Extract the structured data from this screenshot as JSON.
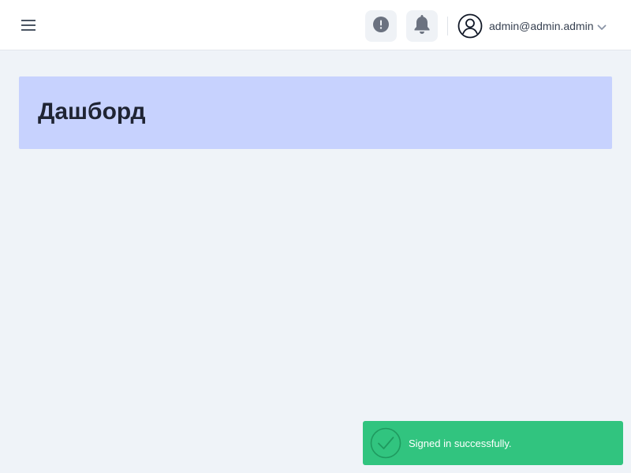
{
  "header": {
    "menu_icon": "hamburger-menu-icon",
    "info_icon": "exclamation-circle-icon",
    "notifications_icon": "bell-icon",
    "user": {
      "avatar_icon": "user-circle-icon",
      "email": "admin@admin.admin",
      "dropdown_icon": "chevron-down-icon"
    }
  },
  "main": {
    "title": "Дашборд"
  },
  "toast": {
    "icon": "check-circle-icon",
    "message": "Signed in successfully.",
    "color": "#31c47f"
  },
  "colors": {
    "background": "#eff3f8",
    "title_card": "#c7d2fe",
    "topbar": "#ffffff"
  }
}
